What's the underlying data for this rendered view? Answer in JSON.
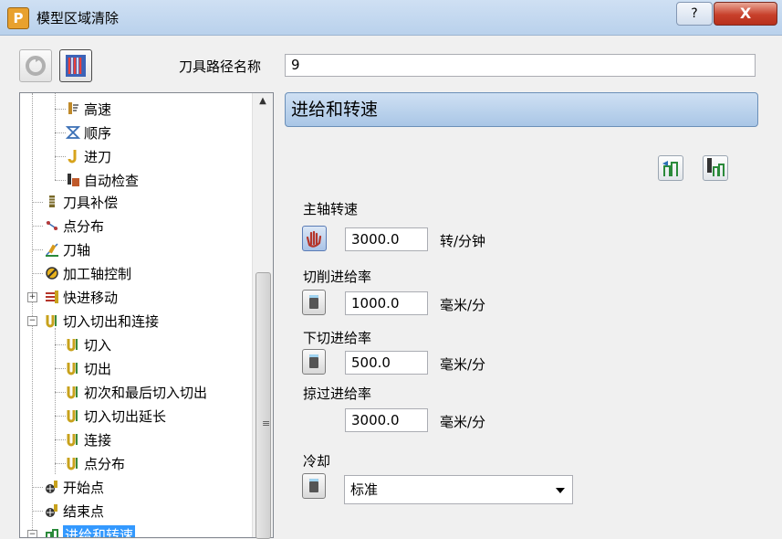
{
  "window": {
    "title": "模型区域清除",
    "app_icon_letter": "P",
    "help_label": "?",
    "close_label": "X"
  },
  "toolpath_name": {
    "label": "刀具路径名称",
    "value": "9"
  },
  "tree": [
    {
      "label": "高速",
      "icon": "high-speed-icon",
      "color": "#c08a2a"
    },
    {
      "label": "顺序",
      "icon": "order-icon",
      "color": "#3a6fb5"
    },
    {
      "label": "进刀",
      "icon": "plunge-icon",
      "color": "#d7a31c"
    },
    {
      "label": "自动检查",
      "icon": "auto-check-icon",
      "color": "#c05a2a"
    },
    {
      "label": "刀具补偿",
      "icon": "tool-compensation-icon",
      "color": "#7a6a2a"
    },
    {
      "label": "点分布",
      "icon": "point-distribution-icon",
      "color": "#b53a3a"
    },
    {
      "label": "刀轴",
      "icon": "tool-axis-icon",
      "color": "#d79a1c"
    },
    {
      "label": "加工轴控制",
      "icon": "axis-control-icon",
      "color": "#333333"
    },
    {
      "label": "快进移动",
      "icon": "rapid-move-icon",
      "color": "#b5352a"
    },
    {
      "label": "切入切出和连接",
      "icon": "leads-links-icon",
      "color": "#c8a21c"
    },
    {
      "label": "切入",
      "icon": "lead-in-icon",
      "color": "#c8a21c"
    },
    {
      "label": "切出",
      "icon": "lead-out-icon",
      "color": "#c8a21c"
    },
    {
      "label": "初次和最后切入切出",
      "icon": "first-last-lead-icon",
      "color": "#c8a21c"
    },
    {
      "label": "切入切出延长",
      "icon": "lead-extension-icon",
      "color": "#c8a21c"
    },
    {
      "label": "连接",
      "icon": "links-icon",
      "color": "#c8a21c"
    },
    {
      "label": "点分布",
      "icon": "point-distribution-icon",
      "color": "#c8a21c"
    },
    {
      "label": "开始点",
      "icon": "start-point-icon",
      "color": "#333333"
    },
    {
      "label": "结束点",
      "icon": "end-point-icon",
      "color": "#333333"
    },
    {
      "label": "进给和转速",
      "icon": "feeds-speeds-icon",
      "color": "#2a8a3a"
    }
  ],
  "panel": {
    "title": "进给和转速",
    "spindle": {
      "label": "主轴转速",
      "value": "3000.0",
      "unit": "转/分钟"
    },
    "cutting": {
      "label": "切削进给率",
      "value": "1000.0",
      "unit": "毫米/分"
    },
    "plunge": {
      "label": "下切进给率",
      "value": "500.0",
      "unit": "毫米/分"
    },
    "skim": {
      "label": "掠过进给率",
      "value": "3000.0",
      "unit": "毫米/分"
    },
    "coolant": {
      "label": "冷却",
      "value": "标准"
    }
  },
  "scrollbar": {
    "up_arrow": "▲",
    "grip": "≡"
  },
  "expander": {
    "collapsed": "+",
    "expanded": "−"
  }
}
